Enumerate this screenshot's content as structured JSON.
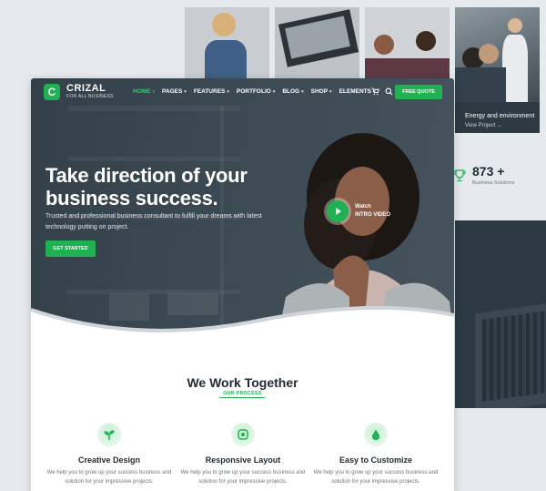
{
  "colors": {
    "accent": "#1fb152",
    "dark": "#2c3a44",
    "text": "#1f2933"
  },
  "background": {
    "energy_card": {
      "title": "Energy and environment",
      "link": "View Project →"
    },
    "stat": {
      "value": "873 +",
      "label": "Business Solutions",
      "icon": "trophy-icon"
    }
  },
  "nav": {
    "logo": {
      "name": "CRIZAL",
      "tagline": "FOR ALL BUSINESS",
      "mark": "C"
    },
    "items": [
      {
        "label": "HOME",
        "active": true
      },
      {
        "label": "PAGES"
      },
      {
        "label": "FEATURES"
      },
      {
        "label": "PORTFOLIO"
      },
      {
        "label": "BLOG"
      },
      {
        "label": "SHOP"
      },
      {
        "label": "ELEMENTS"
      }
    ],
    "cart_icon": "cart-icon",
    "search_icon": "search-icon",
    "cta": "FREE QUOTE"
  },
  "hero": {
    "title_line1": "Take direction of your",
    "title_line2": "business success.",
    "subtitle": "Trusted and professional business consultant to fulfill your dreams with latest technology putting on project.",
    "button": "GET STARTED",
    "video": {
      "line1": "Watch",
      "line2": "INTRO VIDEO",
      "icon": "play-icon"
    }
  },
  "section": {
    "title": "We Work Together",
    "kicker": "OUR PROCESS",
    "features": [
      {
        "title": "Creative Design",
        "desc": "We help you to grow up your success business and solution for your impressive projects.",
        "icon": "sprout-icon"
      },
      {
        "title": "Responsive Layout",
        "desc": "We help you to grow up your success business and solution for your impressive projects.",
        "icon": "responsive-icon"
      },
      {
        "title": "Easy to Customize",
        "desc": "We help you to grow up your success business and solution for your impressive projects.",
        "icon": "drop-icon"
      }
    ]
  }
}
